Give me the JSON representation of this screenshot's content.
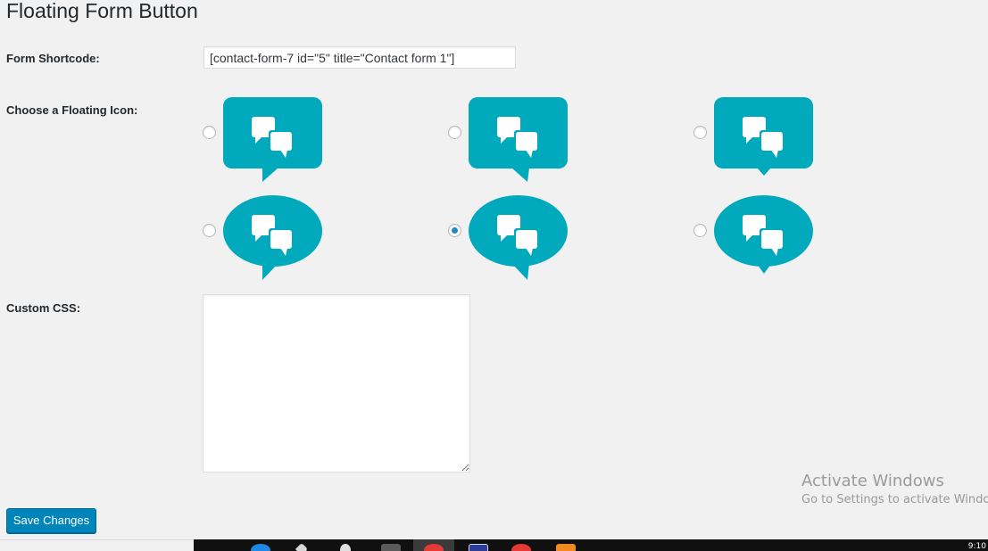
{
  "page": {
    "title": "Floating Form Button"
  },
  "form": {
    "shortcode_label": "Form Shortcode:",
    "shortcode_value": "[contact-form-7 id=\"5\" title=\"Contact form 1\"]",
    "icon_label": "Choose a Floating Icon:",
    "css_label": "Custom CSS:",
    "css_value": "",
    "save_label": "Save Changes",
    "selected_icon_index": 4,
    "icon_options": [
      {
        "shape": "rectangle",
        "tail": "left",
        "selected": false
      },
      {
        "shape": "rectangle",
        "tail": "center",
        "selected": false
      },
      {
        "shape": "rectangle",
        "tail": "center-small",
        "selected": false
      },
      {
        "shape": "ellipse",
        "tail": "left",
        "selected": false
      },
      {
        "shape": "ellipse",
        "tail": "center",
        "selected": true
      },
      {
        "shape": "ellipse",
        "tail": "center-small",
        "selected": false
      }
    ]
  },
  "watermark": {
    "title": "Activate Windows",
    "subtitle": "Go to Settings to activate Windows."
  },
  "taskbar": {
    "clock": "9:10"
  },
  "colors": {
    "icon_teal": "#00a9bb",
    "primary_button": "#0085ba",
    "radio_dot": "#1e8cbe",
    "background": "#f1f1f1"
  }
}
